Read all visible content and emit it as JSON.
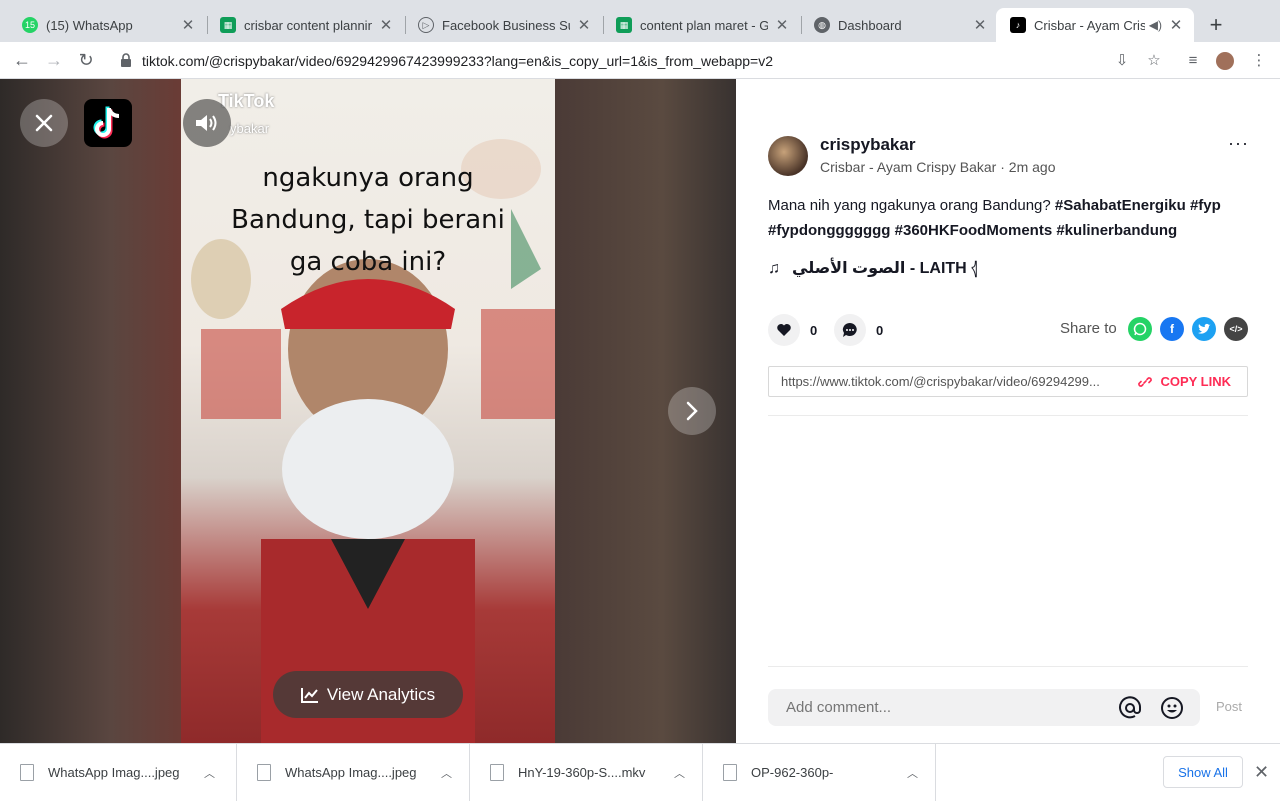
{
  "browser": {
    "tabs": [
      {
        "title": "(15) WhatsApp",
        "badge": "15",
        "active": false
      },
      {
        "title": "crisbar content planning",
        "active": false
      },
      {
        "title": "Facebook Business Suite",
        "active": false
      },
      {
        "title": "content plan maret - Go",
        "active": false
      },
      {
        "title": "Dashboard",
        "active": false
      },
      {
        "title": "Crisbar - Ayam Crisp",
        "active": true
      }
    ],
    "url": "tiktok.com/@crispybakar/video/6929429967423999233?lang=en&is_copy_url=1&is_from_webapp=v2"
  },
  "video": {
    "caption_lines": [
      "ngakunya orang",
      "Bandung, tapi berani",
      "ga coba ini?"
    ],
    "watermark_brand": "TikTok",
    "watermark_user": "ybakar",
    "analytics_label": "View Analytics"
  },
  "post": {
    "username": "crispybakar",
    "subline": "Crisbar - Ayam Crispy Bakar · 2m ago",
    "description_text": "Mana nih yang ngakunya orang Bandung? ",
    "tags": [
      "#SahabatEnergiku",
      "#fyp",
      "#fypdonggggggg",
      "#360HKFoodMoments",
      "#kulinerbandung"
    ],
    "music": "الصوت الأصلي - LAITH 𓂆",
    "likes": "0",
    "comments": "0",
    "share_label": "Share to",
    "link": "https://www.tiktok.com/@crispybakar/video/69294299...",
    "copy_link_label": "COPY LINK",
    "comment_placeholder": "Add comment...",
    "post_label": "Post"
  },
  "downloads": {
    "items": [
      {
        "name": "WhatsApp Imag....jpeg"
      },
      {
        "name": "WhatsApp Imag....jpeg"
      },
      {
        "name": "HnY-19-360p-S....mkv"
      },
      {
        "name": "OP-962-360p-"
      }
    ],
    "show_all_label": "Show All"
  },
  "colors": {
    "tiktok_red": "#fe2c55",
    "whatsapp": "#25d366",
    "facebook": "#1877f2",
    "twitter": "#1da1f2",
    "embed": "#444444"
  }
}
